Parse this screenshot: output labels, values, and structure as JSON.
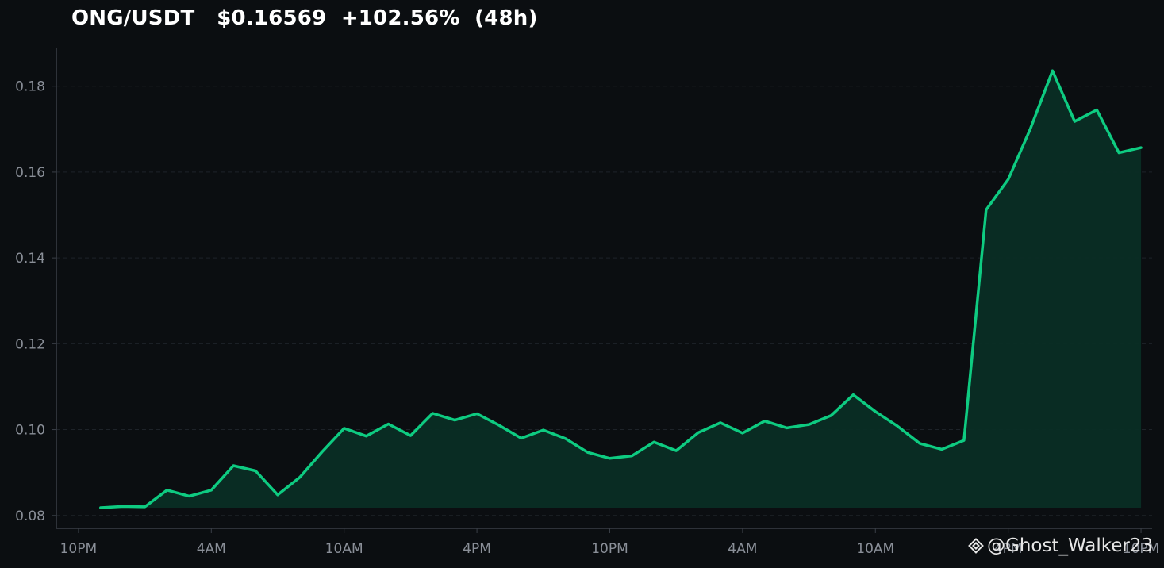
{
  "title": "ONG/USDT   $0.16569  +102.56%  (48h)",
  "watermark": {
    "text": "@Ghost_Walker23",
    "icon": "binance-logo-icon"
  },
  "colors": {
    "background": "#0b0e11",
    "line": "#0ecb81",
    "fill": "#0a2e25",
    "grid": "#1e2329",
    "axis": "#3a3f47",
    "tick_text": "#8a8f98"
  },
  "chart_data": {
    "type": "area",
    "title": "ONG/USDT   $0.16569  +102.56%  (48h)",
    "xlabel": "",
    "ylabel": "",
    "ylim": [
      0.077,
      0.189
    ],
    "xlim": [
      -1,
      48.5
    ],
    "grid": true,
    "legend": "none",
    "yticks": [
      0.08,
      0.1,
      0.12,
      0.14,
      0.16,
      0.18
    ],
    "ytick_labels": [
      "0.08",
      "0.10",
      "0.12",
      "0.14",
      "0.16",
      "0.18"
    ],
    "xticks": [
      0,
      6,
      12,
      18,
      24,
      30,
      36,
      42,
      48
    ],
    "xtick_labels": [
      "10PM",
      "4AM",
      "10AM",
      "4PM",
      "10PM",
      "4AM",
      "10AM",
      "4PM",
      "10PM"
    ],
    "series": [
      {
        "x": [
          1,
          2,
          3,
          4,
          5,
          6,
          7,
          8,
          9,
          10,
          11,
          12,
          13,
          14,
          15,
          16,
          17,
          18,
          19,
          20,
          21,
          22,
          23,
          24,
          25,
          26,
          27,
          28,
          29,
          30,
          31,
          32,
          33,
          34,
          35,
          36,
          37,
          38,
          39,
          40,
          41,
          42,
          43,
          44,
          45,
          46,
          47,
          48
        ],
        "y": [
          0.0818,
          0.0821,
          0.082,
          0.0859,
          0.0845,
          0.0859,
          0.0916,
          0.0904,
          0.0848,
          0.0889,
          0.0948,
          0.1003,
          0.0985,
          0.1013,
          0.0986,
          0.1038,
          0.1022,
          0.1037,
          0.101,
          0.098,
          0.0999,
          0.0979,
          0.0947,
          0.0933,
          0.0939,
          0.0971,
          0.0951,
          0.0993,
          0.1016,
          0.0992,
          0.102,
          0.1004,
          0.1012,
          0.1033,
          0.1081,
          0.1042,
          0.1008,
          0.0968,
          0.0954,
          0.0975,
          0.1512,
          0.1583,
          0.1701,
          0.1836,
          0.1718,
          0.1745,
          0.1645,
          0.1657
        ]
      }
    ]
  }
}
